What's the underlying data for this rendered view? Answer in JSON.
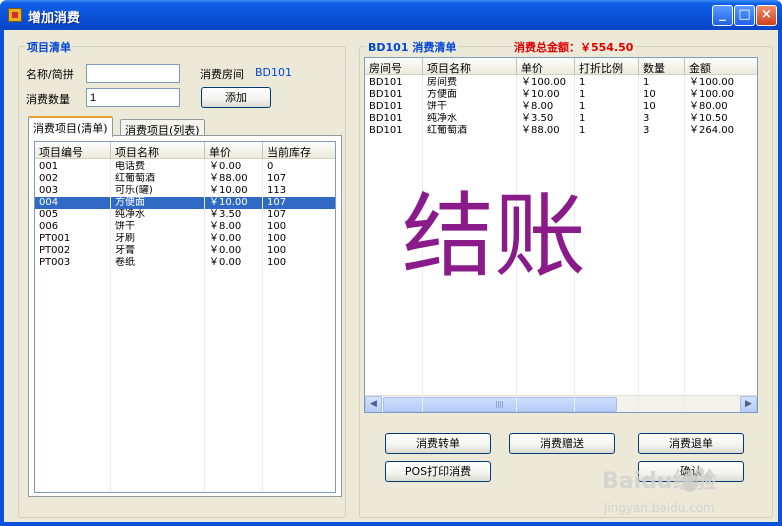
{
  "window": {
    "title": "增加消费"
  },
  "left_group": {
    "title": "项目清单",
    "name_label": "名称/简拼",
    "name_value": "",
    "qty_label": "消费数量",
    "qty_value": "1",
    "room_label": "消费房间",
    "room_value": "BD101",
    "add_button": "添加"
  },
  "tabs": [
    {
      "label": "消费项目(清单)",
      "active": true
    },
    {
      "label": "消费项目(列表)",
      "active": false
    }
  ],
  "items_table": {
    "columns": [
      "项目编号",
      "项目名称",
      "单价",
      "当前库存"
    ],
    "rows": [
      [
        "001",
        "电话费",
        "￥0.00",
        "0"
      ],
      [
        "002",
        "红葡萄酒",
        "￥88.00",
        "107"
      ],
      [
        "003",
        "可乐(罐)",
        "￥10.00",
        "113"
      ],
      [
        "004",
        "方便面",
        "￥10.00",
        "107"
      ],
      [
        "005",
        "纯净水",
        "￥3.50",
        "107"
      ],
      [
        "006",
        "饼干",
        "￥8.00",
        "100"
      ],
      [
        "PT001",
        "牙刷",
        "￥0.00",
        "100"
      ],
      [
        "PT002",
        "牙膏",
        "￥0.00",
        "100"
      ],
      [
        "PT003",
        "卷纸",
        "￥0.00",
        "100"
      ]
    ],
    "selected_row": 3
  },
  "right_group": {
    "title_room": "BD101",
    "title_text": "消费清单",
    "total_label": "消费总金额：",
    "total_value": "￥554.50",
    "total_color": "#e00000"
  },
  "consume_table": {
    "columns": [
      "房间号",
      "项目名称",
      "单价",
      "打折比例",
      "数量",
      "金额"
    ],
    "rows": [
      [
        "BD101",
        "房间费",
        "￥100.00",
        "1",
        "1",
        "￥100.00"
      ],
      [
        "BD101",
        "方便面",
        "￥10.00",
        "1",
        "10",
        "￥100.00"
      ],
      [
        "BD101",
        "饼干",
        "￥8.00",
        "1",
        "10",
        "￥80.00"
      ],
      [
        "BD101",
        "纯净水",
        "￥3.50",
        "1",
        "3",
        "￥10.50"
      ],
      [
        "BD101",
        "红葡萄酒",
        "￥88.00",
        "1",
        "3",
        "￥264.00"
      ]
    ]
  },
  "actions": {
    "transfer": "消费转单",
    "gift": "消费赠送",
    "refund": "消费退单",
    "pos_print": "POS打印消费",
    "confirm": "确认"
  },
  "annotation": {
    "text": "结账",
    "color": "#8b1a8b"
  },
  "watermark": {
    "brand": "Baidu经验",
    "url": "jingyan.baidu.com"
  },
  "colors": {
    "accent": "#0046d5",
    "selection": "#316ac5",
    "title_bar": "#0a52dc"
  }
}
